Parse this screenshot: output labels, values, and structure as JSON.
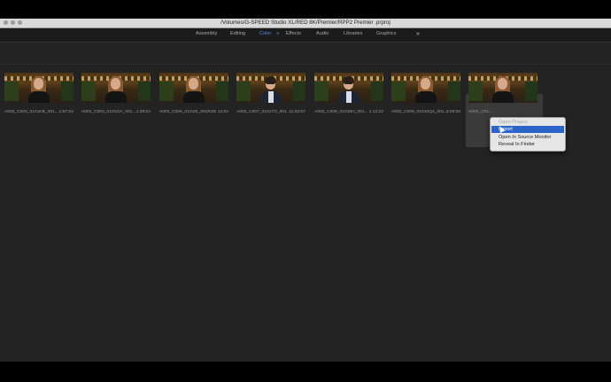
{
  "window": {
    "title": "/Volumes/G-SPEED Studio XL/RED 8K/Premier/RPP2 Premier .prproj"
  },
  "workspaces": {
    "items": [
      {
        "label": "Assembly",
        "active": false
      },
      {
        "label": "Editing",
        "active": false
      },
      {
        "label": "Color",
        "active": true
      },
      {
        "label": "Effects",
        "active": false
      },
      {
        "label": "Audio",
        "active": false
      },
      {
        "label": "Libraries",
        "active": false
      },
      {
        "label": "Graphics",
        "active": false
      }
    ],
    "more_icon": "double-chevron-right-icon"
  },
  "clips": [
    {
      "name": "A002_C004_0101KB_001...",
      "duration": "1:57:02",
      "subject": "woman"
    },
    {
      "name": "A002_C003_0101OA_001...",
      "duration": "1:39:04",
      "subject": "woman"
    },
    {
      "name": "A002_C006_01010I_001R3D",
      "duration": "12:02",
      "subject": "woman"
    },
    {
      "name": "A002_C007_01017O_001...",
      "duration": "11:02:07",
      "subject": "man"
    },
    {
      "name": "A002_C008_01010H_001...",
      "duration": "1:12:22",
      "subject": "man"
    },
    {
      "name": "A002_C009_01010Q4_001...",
      "duration": "3:06:06",
      "subject": "woman"
    },
    {
      "name": "A002_C01...",
      "duration": "",
      "subject": "woman"
    }
  ],
  "context_menu": {
    "items": [
      {
        "label": "Open Project",
        "state": "disabled"
      },
      {
        "label": "Import",
        "state": "highlighted"
      },
      {
        "label": "Open In Source Monitor",
        "state": "normal"
      },
      {
        "label": "Reveal In Finder",
        "state": "normal"
      }
    ]
  },
  "colors": {
    "accent": "#5b8fe0",
    "menu_highlight": "#2a64c8",
    "panel_bg": "#232323"
  }
}
